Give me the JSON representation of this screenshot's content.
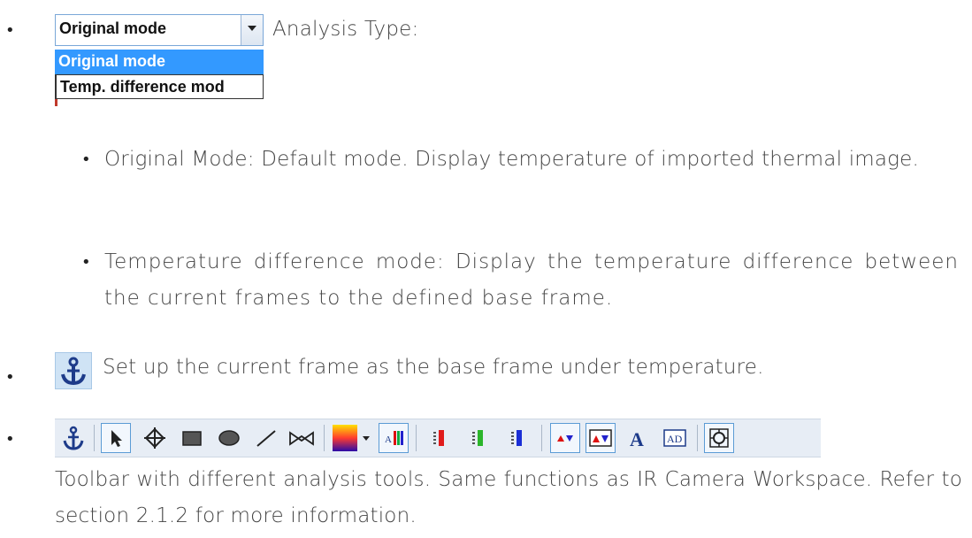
{
  "dropdown": {
    "selected": "Original mode",
    "options": [
      "Original mode",
      "Temp. difference mod"
    ]
  },
  "items": {
    "analysis_type": "Analysis Type:",
    "original_mode_desc": "Original Mode: Default mode. Display temperature of imported thermal image.",
    "temp_diff_desc": "Temperature difference mode: Display the temperature difference between the current frames to the defined base frame.",
    "base_frame_desc": "Set up the current frame as the base frame under temperature.",
    "toolbar_desc": "Toolbar with different analysis tools. Same functions as IR Camera Workspace. Refer to section 2.1.2 for more information."
  },
  "bullets": {
    "main": "•",
    "sub": "•"
  },
  "icons": {
    "dropdown_arrow": "chevron-down-icon",
    "anchor": "anchor-icon",
    "toolbar": [
      "anchor-icon",
      "pointer-icon",
      "crosshair-icon",
      "rectangle-icon",
      "ellipse-icon",
      "line-icon",
      "polygon-icon",
      "palette-icon",
      "palette-dropdown-icon",
      "text-bars-icon",
      "red-bar-icon",
      "green-bar-icon",
      "blue-bar-icon",
      "max-min-icon",
      "max-min-box-icon",
      "font-icon",
      "ad-icon",
      "target-icon"
    ]
  },
  "colors": {
    "accent": "#3399ff",
    "toolbar_bg": "#e7edf5",
    "anchor_btn_bg": "#cfe3f5"
  }
}
